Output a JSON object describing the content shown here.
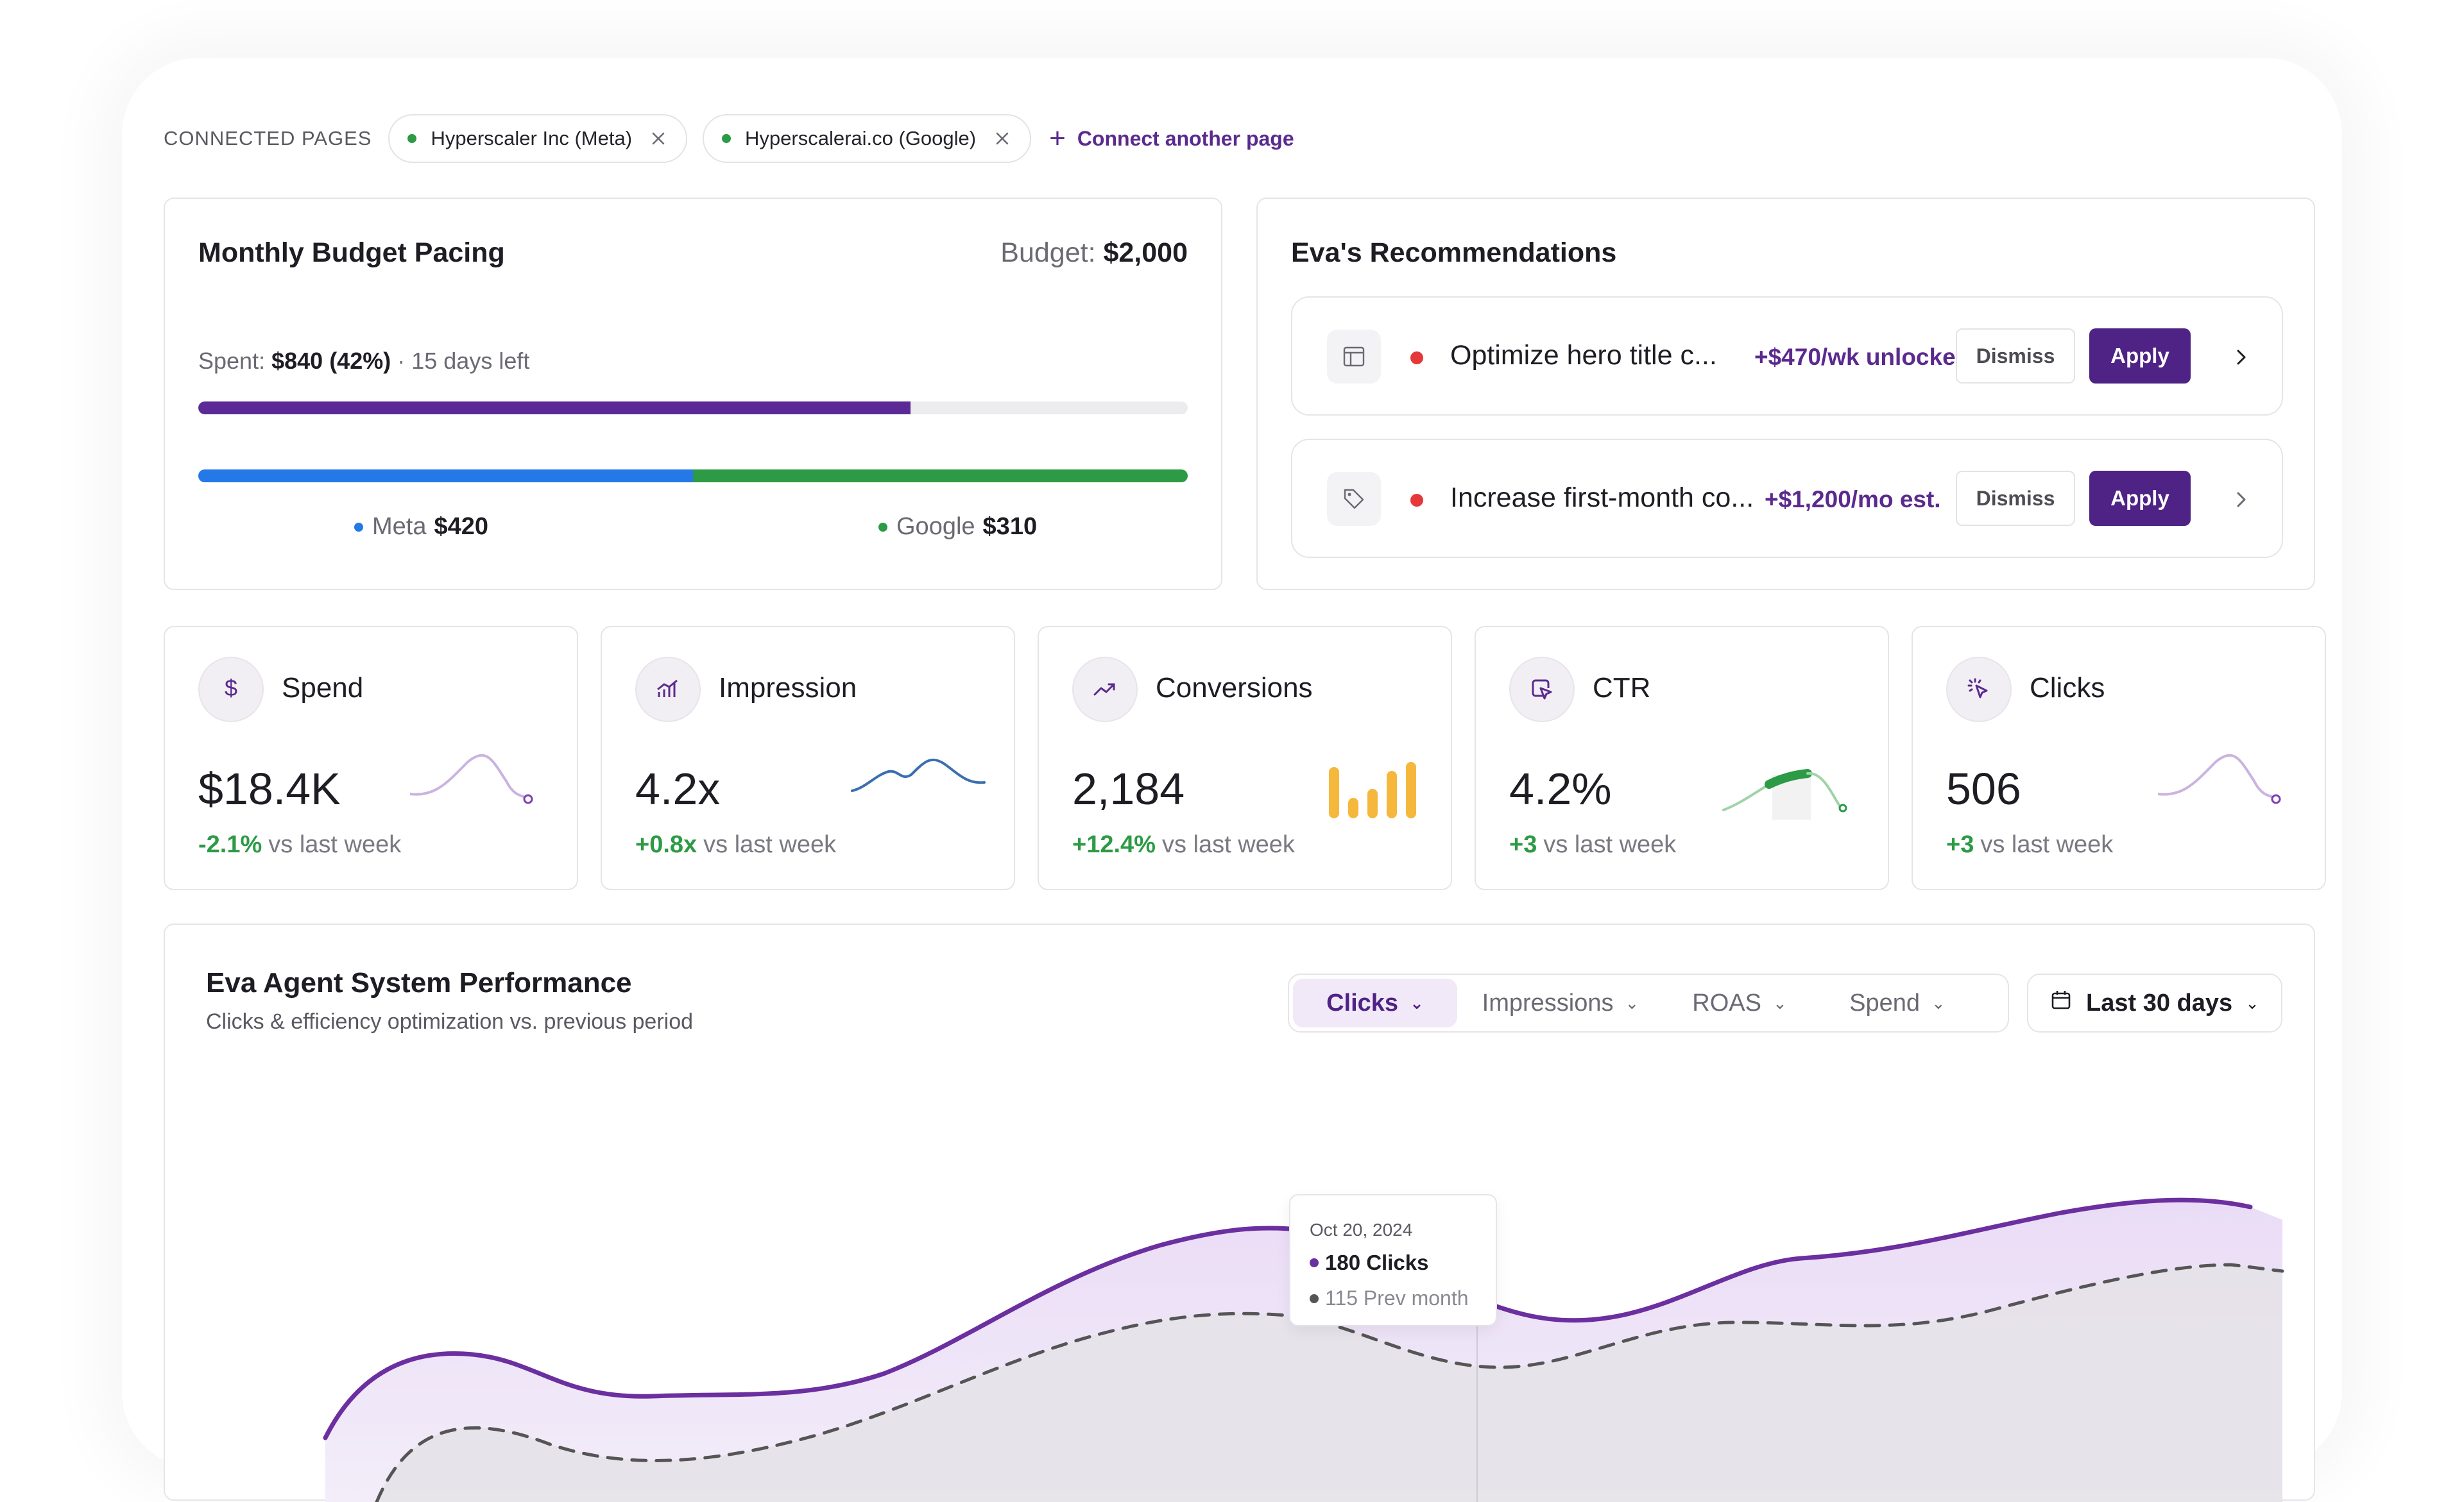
{
  "connected_pages": {
    "label": "CONNECTED PAGES",
    "pages": [
      {
        "name": "Hyperscaler Inc (Meta)"
      },
      {
        "name": "Hyperscalerai.co (Google)"
      }
    ],
    "connect_label": "Connect another page"
  },
  "budget": {
    "title": "Monthly Budget Pacing",
    "budget_label": "Budget:",
    "budget_value": "$2,000",
    "spent_label": "Spent:",
    "spent_value": "$840 (42%)",
    "days_left": "· 15 days left",
    "progress_fraction": 0.72,
    "meta_fraction": 0.5,
    "meta_label": "Meta",
    "meta_value": "$420",
    "google_label": "Google",
    "google_value": "$310",
    "colors": {
      "meta": "#2478e8",
      "google": "#2d9a45",
      "pacing": "#5b2a96"
    }
  },
  "recommendations": {
    "title": "Eva's Recommendations",
    "items": [
      {
        "icon": "layout-icon",
        "text": "Optimize hero title c...",
        "gain": "+$470/wk unlocked",
        "dismiss": "Dismiss",
        "apply": "Apply"
      },
      {
        "icon": "tag-icon",
        "text": "Increase first-month co...",
        "gain": "+$1,200/mo est.",
        "dismiss": "Dismiss",
        "apply": "Apply"
      }
    ]
  },
  "metrics": [
    {
      "icon": "dollar-icon",
      "name": "Spend",
      "value": "$18.4K",
      "delta": "-2.1%",
      "delta_suffix": "vs last week"
    },
    {
      "icon": "bar-chart-icon",
      "name": "Impression",
      "value": "4.2x",
      "delta": "+0.8x",
      "delta_suffix": "vs last week"
    },
    {
      "icon": "trend-up-icon",
      "name": "Conversions",
      "value": "2,184",
      "delta": "+12.4%",
      "delta_suffix": "vs last week"
    },
    {
      "icon": "cursor-box-icon",
      "name": "CTR",
      "value": "4.2%",
      "delta": "+3",
      "delta_suffix": "vs last week"
    },
    {
      "icon": "click-icon",
      "name": "Clicks",
      "value": "506",
      "delta": "+3",
      "delta_suffix": "vs last week"
    }
  ],
  "performance": {
    "title": "Eva Agent System Performance",
    "subtitle": "Clicks & efficiency optimization vs. previous period",
    "tabs": [
      "Clicks",
      "Impressions",
      "ROAS",
      "Spend"
    ],
    "active_tab": "Clicks",
    "range": "Last 30 days",
    "tooltip": {
      "date": "Oct 20, 2024",
      "current": "180 Clicks",
      "previous": "115 Prev month"
    },
    "colors": {
      "current": "#6b2fa0",
      "previous": "#555555"
    }
  }
}
